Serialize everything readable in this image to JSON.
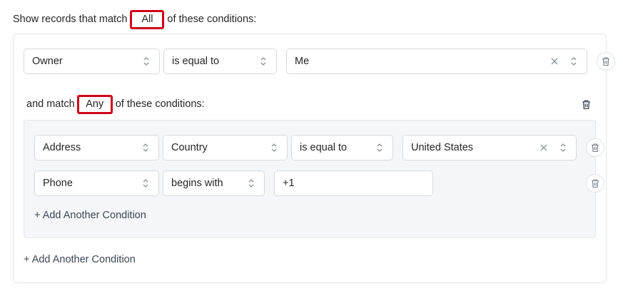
{
  "header": {
    "prefix": "Show records that match",
    "match_value": "All",
    "suffix": "of these conditions:"
  },
  "conditions": [
    {
      "field": "Owner",
      "operator": "is equal to",
      "value": "Me"
    }
  ],
  "group": {
    "prefix": "and match",
    "match_value": "Any",
    "suffix": "of these conditions:",
    "conditions": [
      {
        "field": "Address",
        "subfield": "Country",
        "operator": "is equal to",
        "value": "United States"
      },
      {
        "field": "Phone",
        "operator": "begins with",
        "value": "+1"
      }
    ],
    "add_label": "+ Add Another Condition"
  },
  "add_label": "+ Add Another Condition",
  "icons": {
    "select": "chevron-updown-icon",
    "clear": "close-icon",
    "delete": "trash-icon"
  },
  "colors": {
    "highlight": "#d0021b",
    "border": "#d6d9de",
    "group_bg": "#f4f6f9"
  }
}
